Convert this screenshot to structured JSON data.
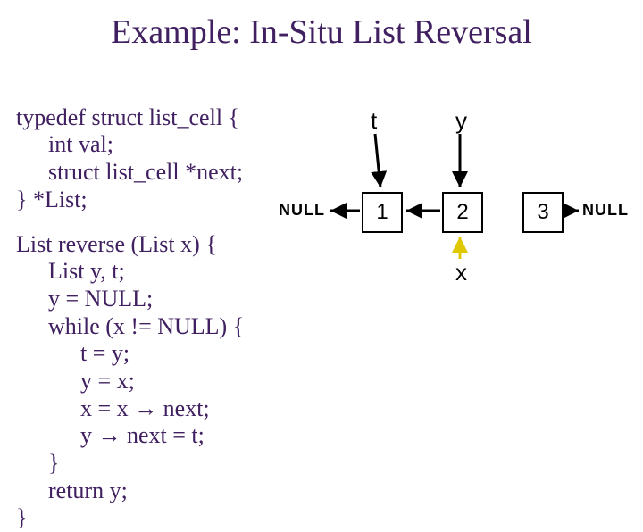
{
  "title": "Example: In-Situ List Reversal",
  "typedef": {
    "l1": "typedef struct list_cell {",
    "l2": "int val;",
    "l3": "struct list_cell *next;",
    "l4": "} *List;"
  },
  "func": {
    "l1": "List reverse (List x) {",
    "l2": "List y, t;",
    "l3": "y = NULL;",
    "l4": "while (x != NULL) {",
    "l5": "t = y;",
    "l6": "y = x;",
    "l7a": "x = x ",
    "l7b": " next;",
    "l8a": "y ",
    "l8b": " next = t;",
    "l9": "}",
    "l10": "return y;",
    "l11": "}"
  },
  "arrow_glyph": "→",
  "diagram": {
    "ptr_t": "t",
    "ptr_y": "y",
    "ptr_x": "x",
    "node1": "1",
    "node2": "2",
    "node3": "3",
    "null": "NULL"
  }
}
